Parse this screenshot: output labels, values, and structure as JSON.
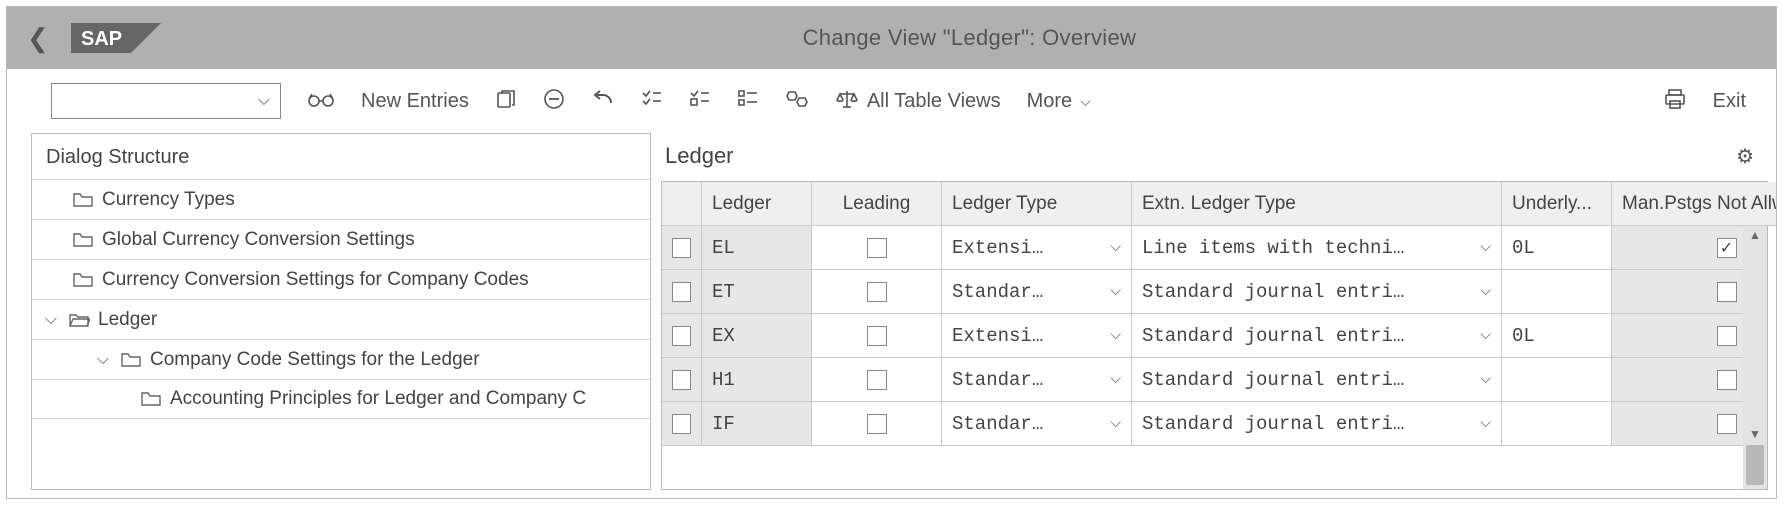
{
  "header": {
    "title": "Change View \"Ledger\": Overview"
  },
  "toolbar": {
    "dropdown_value": "",
    "new_entries": "New Entries",
    "all_table_views": "All Table Views",
    "more": "More",
    "exit": "Exit"
  },
  "tree": {
    "title": "Dialog Structure",
    "items": [
      {
        "label": "Currency Types"
      },
      {
        "label": "Global Currency Conversion Settings"
      },
      {
        "label": "Currency Conversion Settings for Company Codes"
      },
      {
        "label": "Ledger"
      },
      {
        "label": "Company Code Settings for the Ledger"
      },
      {
        "label": "Accounting Principles for Ledger and Company C"
      }
    ]
  },
  "pane": {
    "title": "Ledger"
  },
  "table": {
    "columns": {
      "ledger": "Ledger",
      "leading": "Leading",
      "ledger_type": "Ledger Type",
      "extn_type": "Extn. Ledger Type",
      "underly": "Underly...",
      "manpstgs": "Man.Pstgs Not Allwd"
    },
    "rows": [
      {
        "ledger": "EL",
        "leading": false,
        "ledger_type": "Extensi…",
        "extn_type": "Line items with techni…",
        "underly": "0L",
        "manpstgs": true
      },
      {
        "ledger": "ET",
        "leading": false,
        "ledger_type": "Standar…",
        "extn_type": "Standard journal entri…",
        "underly": "",
        "manpstgs": false
      },
      {
        "ledger": "EX",
        "leading": false,
        "ledger_type": "Extensi…",
        "extn_type": "Standard journal entri…",
        "underly": "0L",
        "manpstgs": false
      },
      {
        "ledger": "H1",
        "leading": false,
        "ledger_type": "Standar…",
        "extn_type": "Standard journal entri…",
        "underly": "",
        "manpstgs": false
      },
      {
        "ledger": "IF",
        "leading": false,
        "ledger_type": "Standar…",
        "extn_type": "Standard journal entri…",
        "underly": "",
        "manpstgs": false
      }
    ]
  }
}
